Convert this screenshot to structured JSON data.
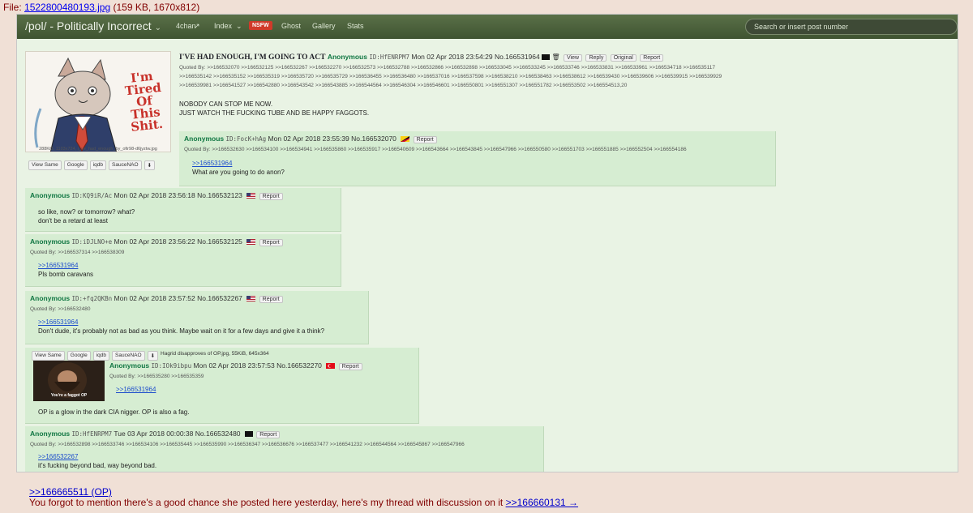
{
  "file": {
    "prefix": "File: ",
    "name": "1522800480193.jpg",
    "meta": "(159 KB, 1670x812)"
  },
  "topbar": {
    "board": "/pol/ - Politically Incorrect",
    "nav": [
      "4chan",
      "Index",
      "Ghost",
      "Gallery",
      "Stats"
    ],
    "nsfw": "NSFW",
    "search_placeholder": "Search or insert post number"
  },
  "op": {
    "image_text": "I'm Tired Of This Shit.",
    "image_meta": "288KiB, 1103x724, i_ve_had_enough_by_ofir98-d6jyztw.jpg",
    "image_buttons": [
      "View Same",
      "Google",
      "iqdb",
      "SauceNAO"
    ],
    "subject": "I'VE HAD ENOUGH, I'M GOING TO ACT",
    "name": "Anonymous",
    "uid": "ID:HfENRPM7",
    "date": "Mon 02 Apr 2018 23:54:29",
    "no": "No.166531964",
    "buttons": [
      "View",
      "Reply",
      "Original",
      "Report"
    ],
    "quoted_1": "Quoted By: >>166532070 >>166532125 >>166532267 >>166532270 >>166532573 >>166532788 >>166532866 >>166532898 >>166533045 >>166533245 >>166533746 >>166533831 >>166533961 >>166534718 >>166535117",
    "quoted_2": ">>166535142 >>166535152 >>166535319 >>166535720 >>166535729 >>166536455 >>166536480 >>166537016 >>166537598 >>166538210 >>166538463 >>166538612 >>166539430 >>166539606 >>166539915 >>166539929",
    "quoted_3": ">>166539981 >>166541527 >>166542880 >>166543542 >>166543885 >>166544564 >>166546304 >>166546601 >>166550801 >>166551307 >>166551782 >>166553502 >>166554513,20",
    "body_1": "NOBODY CAN STOP ME NOW.",
    "body_2": "JUST WATCH THE FUCKING TUBE AND BE HAPPY FAGGOTS."
  },
  "replies": [
    {
      "name": "Anonymous",
      "uid": "ID:FocK+hAg",
      "date": "Mon 02 Apr 2018 23:55:39",
      "no": "No.166532070",
      "report": "Report",
      "quoted": "Quoted By: >>166532630 >>166534100 >>166534941 >>166535860 >>166535917 >>166540609 >>166543664 >>166543845 >>166547966 >>166550580 >>166551703 >>166551885 >>166552504 >>166554186",
      "link": ">>166531964",
      "text": "What are you going to do anon?",
      "flag": "sc"
    },
    {
      "name": "Anonymous",
      "uid": "ID:KQ9iR/Ac",
      "date": "Mon 02 Apr 2018 23:56:18",
      "no": "No.166532123",
      "report": "Report",
      "text_1": "so like, now? or tomorrow? what?",
      "text_2": "don't be a retard at least",
      "flag": "us"
    },
    {
      "name": "Anonymous",
      "uid": "ID:iDJLNO+e",
      "date": "Mon 02 Apr 2018 23:56:22",
      "no": "No.166532125",
      "report": "Report",
      "quoted": "Quoted By: >>166537314 >>166538309",
      "link": ">>166531964",
      "text": "Pls bomb caravans",
      "flag": "us"
    },
    {
      "name": "Anonymous",
      "uid": "ID:+fq2QKBn",
      "date": "Mon 02 Apr 2018 23:57:52",
      "no": "No.166532267",
      "report": "Report",
      "quoted": "Quoted By: >>166532480",
      "link": ">>166531964",
      "text": "Don't dude, it's probably not as bad as you think. Maybe wait on it for a few days and give it a think?",
      "flag": "us"
    },
    {
      "name": "Anonymous",
      "uid": "ID:IOk9ibpu",
      "date": "Mon 02 Apr 2018 23:57:53",
      "no": "No.166532270",
      "report": "Report",
      "img_buttons": [
        "View Same",
        "Google",
        "iqdb",
        "SauceNAO"
      ],
      "file": "Hagrid disapproves of OP.jpg, 55KiB, 645x364",
      "img_caption": "You're a faggot OP",
      "quoted": "Quoted By: >>166535280 >>166535359",
      "link": ">>166531964",
      "text": "OP is a glow in the dark CIA nigger. OP is also a fag.",
      "flag": "tr"
    },
    {
      "name": "Anonymous",
      "uid": "ID:HfENRPM7",
      "date": "Tue 03 Apr 2018 00:00:38",
      "no": "No.166532480",
      "report": "Report",
      "quoted": "Quoted By: >>166532898 >>166533746 >>166534106 >>166535445 >>166535990 >>166536347 >>166536676 >>166537477 >>166541232 >>166544564 >>166545867 >>166547966",
      "link": ">>166532267",
      "text": "it's fucking beyond bad, way beyond bad.",
      "flag": "pirate"
    }
  ],
  "bottom": {
    "ref": ">>166665511 (OP)",
    "text": "You forgot to mention there's a good chance she posted here yesterday, here's my thread with discussion on it ",
    "link": ">>166660131 →"
  }
}
